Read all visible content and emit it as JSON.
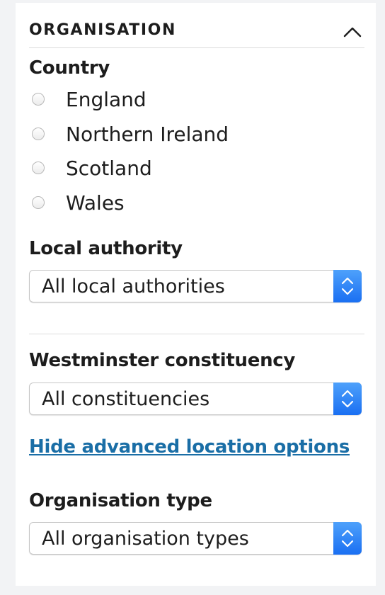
{
  "section": {
    "title": "ORGANISATION"
  },
  "country": {
    "label": "Country",
    "options": [
      {
        "label": "England",
        "selected": false
      },
      {
        "label": "Northern Ireland",
        "selected": false
      },
      {
        "label": "Scotland",
        "selected": false
      },
      {
        "label": "Wales",
        "selected": false
      }
    ]
  },
  "local_authority": {
    "label": "Local authority",
    "selected": "All local authorities"
  },
  "westminster_constituency": {
    "label": "Westminster constituency",
    "selected": "All constituencies"
  },
  "advanced_link": {
    "label": "Hide advanced location options"
  },
  "organisation_type": {
    "label": "Organisation type",
    "selected": "All organisation types"
  },
  "icons": {
    "collapse": "chevron-up-icon",
    "select": "select-arrows-icon"
  },
  "colors": {
    "link": "#1a6ea6",
    "select_accent": "#2f86f6"
  }
}
